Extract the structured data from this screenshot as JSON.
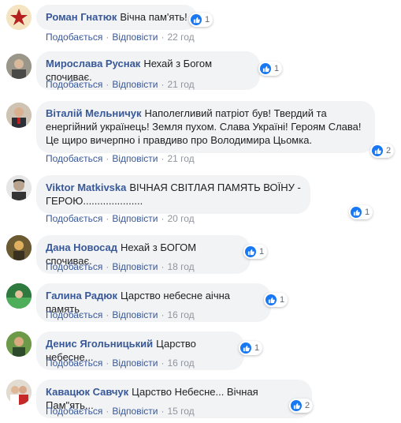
{
  "like_label": "Подобається",
  "reply_label": "Відповісти",
  "separator": "·",
  "colors": {
    "link": "#385898",
    "bubble": "#f2f3f5",
    "like": "#1877f2",
    "meta": "#90949c"
  },
  "comments": [
    {
      "author": "Роман Гнатюк",
      "text": "Вічна пам'ять!",
      "reactions": "1",
      "time": "22 год"
    },
    {
      "author": "Мирослава Руснак",
      "text": "Нехай з Богом спочиває.",
      "reactions": "1",
      "time": "21 год"
    },
    {
      "author": "Віталій Мельничук",
      "text": "Наполегливий патріот був! Твердий та енергійний українець! Земля пухом. Слава Україні! Героям Слава! Це щиро вичерпно і правдиво про Володимира Цьомка.",
      "reactions": "2",
      "time": "21 год"
    },
    {
      "author": "Viktor Matkivska",
      "text": "ВІЧНАЯ СВІТЛАЯ ПАМЯТЬ ВОЇНУ - ГЕРОЮ.....................",
      "reactions": "1",
      "time": "20 год"
    },
    {
      "author": "Дана Новосад",
      "text": "Нехай з БОГОМ спочиває.",
      "reactions": "1",
      "time": "18 год"
    },
    {
      "author": "Галина Радюк",
      "text": "Царство небесне аічна память",
      "reactions": "1",
      "time": "16 год"
    },
    {
      "author": "Денис Ягольницький",
      "text": "Царство небесне...",
      "reactions": "1",
      "time": "16 год"
    },
    {
      "author": "Кавацюк Савчук",
      "text": "Царство Небесне... Вічная Пам\"ять...",
      "reactions": "2",
      "time": "15 год"
    }
  ]
}
